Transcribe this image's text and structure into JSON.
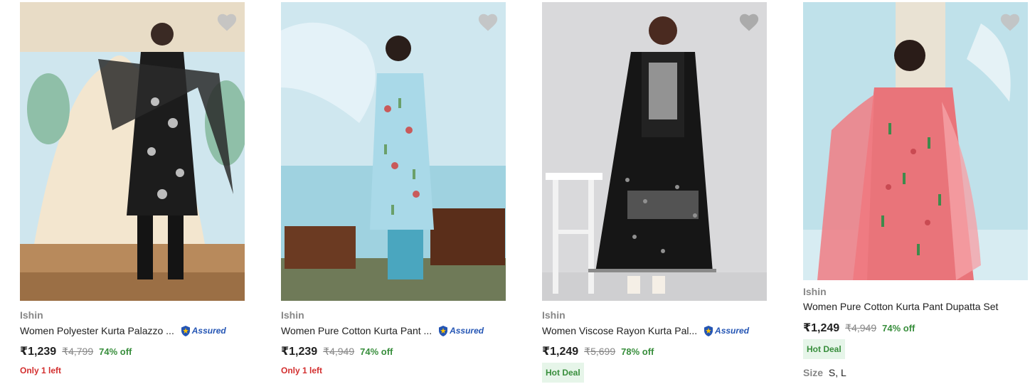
{
  "products": [
    {
      "brand": "Ishin",
      "title": "Women Polyester Kurta Palazzo ...",
      "assured": "Assured",
      "price": "₹1,239",
      "mrp": "₹4,799",
      "discount": "74% off",
      "stock_note": "Only 1 left",
      "image_theme": "black kurta with dupatta, garden backdrop",
      "colors": {
        "garment": "#1c1c1c",
        "bg": "#cfe6ee"
      }
    },
    {
      "brand": "Ishin",
      "title": "Women Pure Cotton Kurta Pant ...",
      "assured": "Assured",
      "price": "₹1,239",
      "mrp": "₹4,949",
      "discount": "74% off",
      "stock_note": "Only 1 left",
      "image_theme": "light blue printed kurta, blue backdrop",
      "colors": {
        "garment": "#a9d9e8",
        "bg": "#f0e3cf"
      }
    },
    {
      "brand": "Ishin",
      "title": "Women Viscose Rayon Kurta Pal...",
      "assured": "Assured",
      "price": "₹1,249",
      "mrp": "₹5,699",
      "discount": "78% off",
      "badge": "Hot Deal",
      "image_theme": "black embroidered kurta, grey studio",
      "colors": {
        "garment": "#161616",
        "bg": "#d9d9db"
      }
    },
    {
      "brand": "Ishin",
      "title": "Women Pure Cotton Kurta Pant Dupatta Set",
      "price": "₹1,249",
      "mrp": "₹4,949",
      "discount": "74% off",
      "badge": "Hot Deal",
      "size_label": "Size",
      "sizes": "S, L",
      "image_theme": "coral pink printed kurta, blue backdrop",
      "colors": {
        "garment": "#e9747a",
        "bg": "#bfe1ea"
      }
    }
  ],
  "theme": {
    "discount_color": "#388e3c",
    "stock_color": "#d32f2f",
    "assured_color": "#2455b4"
  }
}
